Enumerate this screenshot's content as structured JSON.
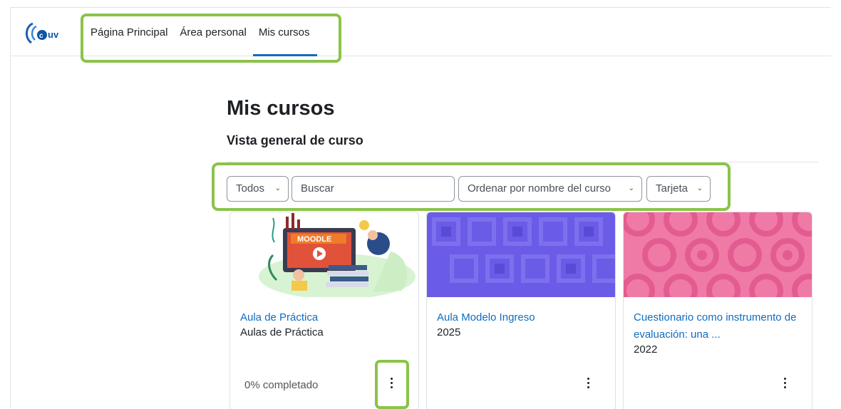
{
  "nav": {
    "items": [
      "Página Principal",
      "Área personal",
      "Mis cursos"
    ],
    "active_index": 2
  },
  "header": {
    "title": "Mis cursos",
    "subtitle": "Vista general de curso"
  },
  "filters": {
    "grouping": "Todos",
    "search_placeholder": "Buscar",
    "sort": "Ordenar por nombre del curso",
    "view": "Tarjeta"
  },
  "courses": [
    {
      "name": "Aula de Práctica",
      "category": "Aulas de Práctica",
      "progress_label": "0% completado",
      "progress_percent": 0,
      "image_label": "MOODLE"
    },
    {
      "name": "Aula Modelo Ingreso",
      "category": "2025"
    },
    {
      "name": "Cuestionario como instrumento de evaluación: una ...",
      "category": "2022"
    }
  ],
  "colors": {
    "highlight": "#8bc34a",
    "link": "#0f6cbf",
    "card2_bg": "#6b5ce7",
    "card3_bg": "#f07aa6"
  }
}
